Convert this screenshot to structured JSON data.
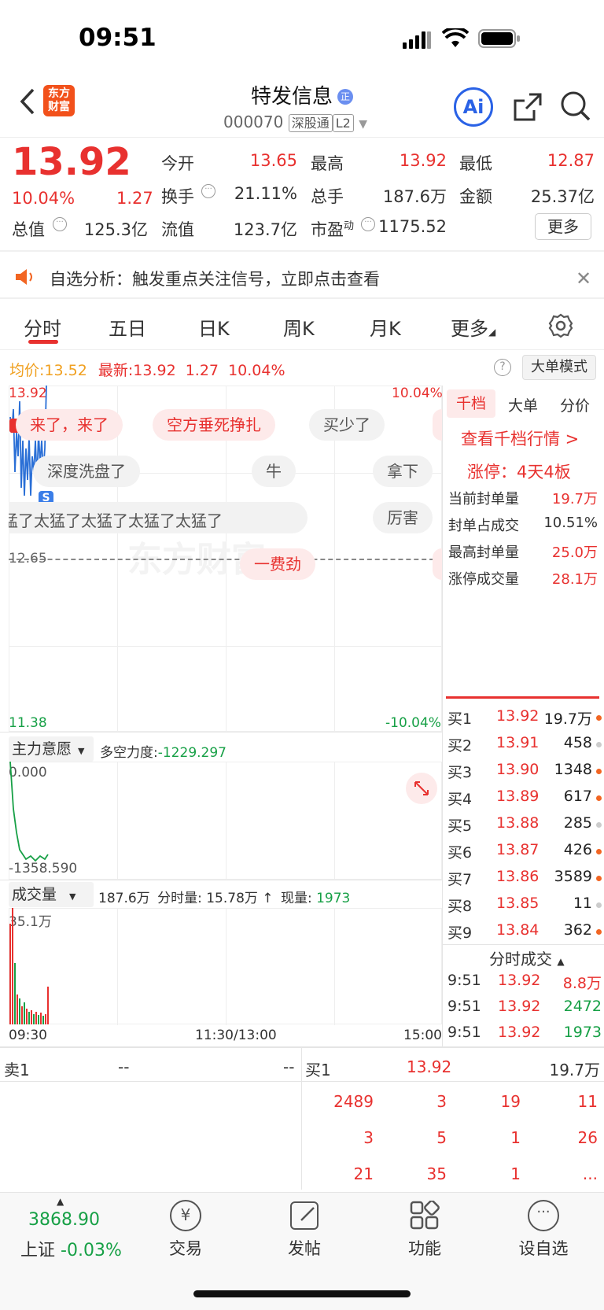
{
  "status_bar": {
    "time": "09:51"
  },
  "header": {
    "logo_text": "东方\n财富",
    "title": "特发信息",
    "title_badge": "正",
    "code": "000070",
    "tag1": "深股通",
    "tag2": "L2",
    "ai_label": "Ai"
  },
  "quote": {
    "price": "13.92",
    "change_pct": "10.04%",
    "change": "1.27",
    "open_label": "今开",
    "open_value": "13.65",
    "high_label": "最高",
    "high_value": "13.92",
    "low_label": "最低",
    "low_value": "12.87",
    "turnover_label": "换手",
    "turnover_value": "21.11%",
    "total_hand_label": "总手",
    "total_hand_value": "187.6万",
    "amount_label": "金额",
    "amount_value": "25.37亿",
    "mktcap_label": "总值",
    "mktcap_value": "125.3亿",
    "float_label": "流值",
    "float_value": "123.7亿",
    "pe_label": "市盈",
    "pe_sup": "动",
    "pe_value": "1175.52",
    "more_button": "更多"
  },
  "notice": {
    "text": "自选分析：触发重点关注信号，立即点击查看"
  },
  "tabs": [
    {
      "label": "分时",
      "active": true
    },
    {
      "label": "五日"
    },
    {
      "label": "日K"
    },
    {
      "label": "周K"
    },
    {
      "label": "月K"
    },
    {
      "label": "更多"
    }
  ],
  "chart_info": {
    "avg_label": "均价:",
    "avg_value": "13.52",
    "latest_label": "最新:",
    "latest_value": "13.92",
    "latest_change": "1.27",
    "latest_pct": "10.04%",
    "big_order_mode": "大单模式"
  },
  "chart_labels": {
    "top_price": "13.92",
    "top_pct": "10.04%",
    "mid_price": "12.65",
    "bottom_price": "11.38",
    "bottom_pct": "-10.04%",
    "time_start": "09:30",
    "time_mid": "11:30/13:00",
    "time_end": "15:00",
    "s_marker": "S"
  },
  "danmaku": {
    "b1": "来了，来了",
    "b2": "空方垂死挣扎",
    "b3": "买少了",
    "b4": "深度洗盘了",
    "b5": "牛",
    "b6": "拿下",
    "b7": "猛了太猛了太猛了太猛了太猛了",
    "b8": "厉害",
    "b9": "一费劲"
  },
  "watermark": "东方财富",
  "indicator": {
    "name": "主力意愿",
    "force_label": "多空力度:",
    "force_value": "-1229.297",
    "top_value": "0.000",
    "bottom_value": "-1358.590"
  },
  "volume": {
    "name": "成交量",
    "total": "187.6万",
    "minute_label": "分时量:",
    "minute_value": "15.78万",
    "arrow": "↑",
    "now_label": "现量:",
    "now_value": "1973",
    "max_label": "35.1万"
  },
  "side_panel": {
    "tabs": [
      "千档",
      "大单",
      "分价"
    ],
    "view_link": "查看千档行情 >",
    "limit_up": "涨停：4天4板",
    "stats": [
      {
        "label": "当前封单量",
        "value": "19.7万"
      },
      {
        "label": "封单占成交",
        "value": "10.51%"
      },
      {
        "label": "最高封单量",
        "value": "25.0万"
      },
      {
        "label": "涨停成交量",
        "value": "28.1万"
      }
    ],
    "order_book": [
      {
        "label": "买1",
        "price": "13.92",
        "vol": "19.7万",
        "dot": "#f26522"
      },
      {
        "label": "买2",
        "price": "13.91",
        "vol": "458",
        "dot": "#ccc"
      },
      {
        "label": "买3",
        "price": "13.90",
        "vol": "1348",
        "dot": "#f26522"
      },
      {
        "label": "买4",
        "price": "13.89",
        "vol": "617",
        "dot": "#f26522"
      },
      {
        "label": "买5",
        "price": "13.88",
        "vol": "285",
        "dot": "#ccc"
      },
      {
        "label": "买6",
        "price": "13.87",
        "vol": "426",
        "dot": "#f26522"
      },
      {
        "label": "买7",
        "price": "13.86",
        "vol": "3589",
        "dot": "#f26522"
      },
      {
        "label": "买8",
        "price": "13.85",
        "vol": "11",
        "dot": "#ccc"
      },
      {
        "label": "买9",
        "price": "13.84",
        "vol": "362",
        "dot": "#f26522"
      }
    ],
    "ticks_title": "分时成交",
    "ticks": [
      {
        "time": "9:51",
        "price": "13.92",
        "vol": "8.8万"
      },
      {
        "time": "9:51",
        "price": "13.92",
        "vol": "2472"
      },
      {
        "time": "9:51",
        "price": "13.92",
        "vol": "1973"
      }
    ]
  },
  "bottom_detail": {
    "sell_label": "卖1",
    "sell_price": "--",
    "sell_vol": "--",
    "buy_label": "买1",
    "buy_price": "13.92",
    "buy_vol": "19.7万",
    "rows": [
      [
        "2489",
        "3",
        "19",
        "11"
      ],
      [
        "3",
        "5",
        "1",
        "26"
      ],
      [
        "21",
        "35",
        "1",
        "..."
      ]
    ]
  },
  "bottom_nav": {
    "index_value": "3868.90",
    "index_name": "上证",
    "index_change": "-0.03%",
    "items": [
      "交易",
      "发帖",
      "功能",
      "设自选"
    ]
  }
}
